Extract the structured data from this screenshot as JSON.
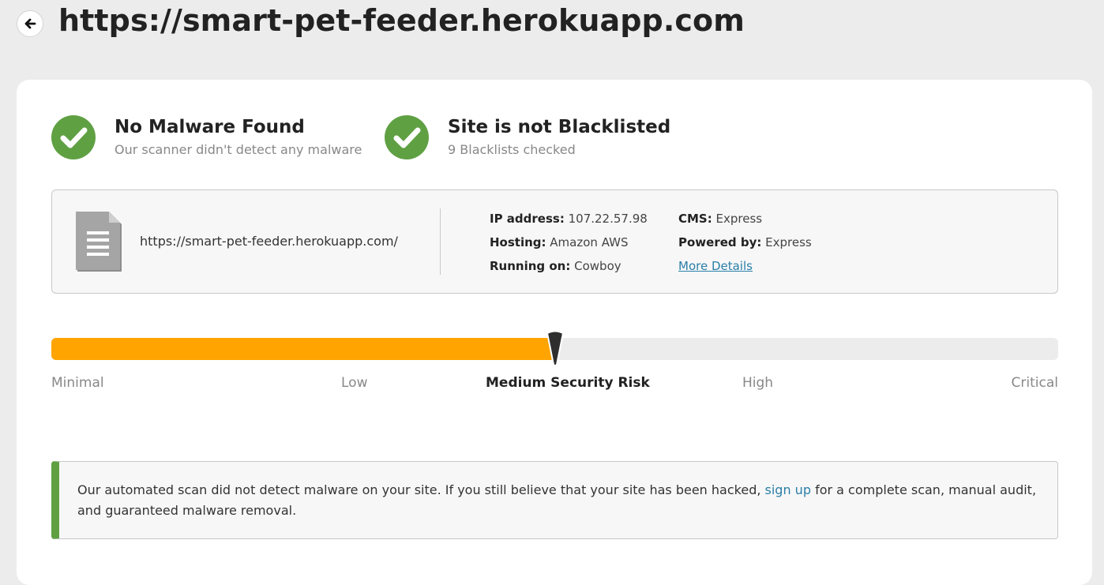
{
  "header": {
    "back_label": "Back",
    "title": "https://smart-pet-feeder.herokuapp.com"
  },
  "status": {
    "malware": {
      "title": "No Malware Found",
      "subtitle": "Our scanner didn't detect any malware"
    },
    "blacklist": {
      "title": "Site is not Blacklisted",
      "subtitle": "9 Blacklists checked"
    }
  },
  "site_info": {
    "url": "https://smart-pet-feeder.herokuapp.com/",
    "ip_label": "IP address:",
    "ip_value": "107.22.57.98",
    "hosting_label": "Hosting:",
    "hosting_value": "Amazon AWS",
    "running_label": "Running on:",
    "running_value": "Cowboy",
    "cms_label": "CMS:",
    "cms_value": "Express",
    "powered_label": "Powered by:",
    "powered_value": "Express",
    "more_details": "More Details"
  },
  "risk": {
    "level_fraction": 0.5,
    "labels": {
      "minimal": "Minimal",
      "low": "Low",
      "medium": "Medium Security Risk",
      "high": "High",
      "critical": "Critical"
    }
  },
  "notice": {
    "text_before": "Our automated scan did not detect malware on your site. If you still believe that your site has been hacked, ",
    "link": "sign up",
    "text_after": " for a complete scan, manual audit, and guaranteed malware removal."
  },
  "colors": {
    "success_green": "#5fa043",
    "risk_orange": "#ffa400",
    "link_blue": "#2a7fa8"
  }
}
